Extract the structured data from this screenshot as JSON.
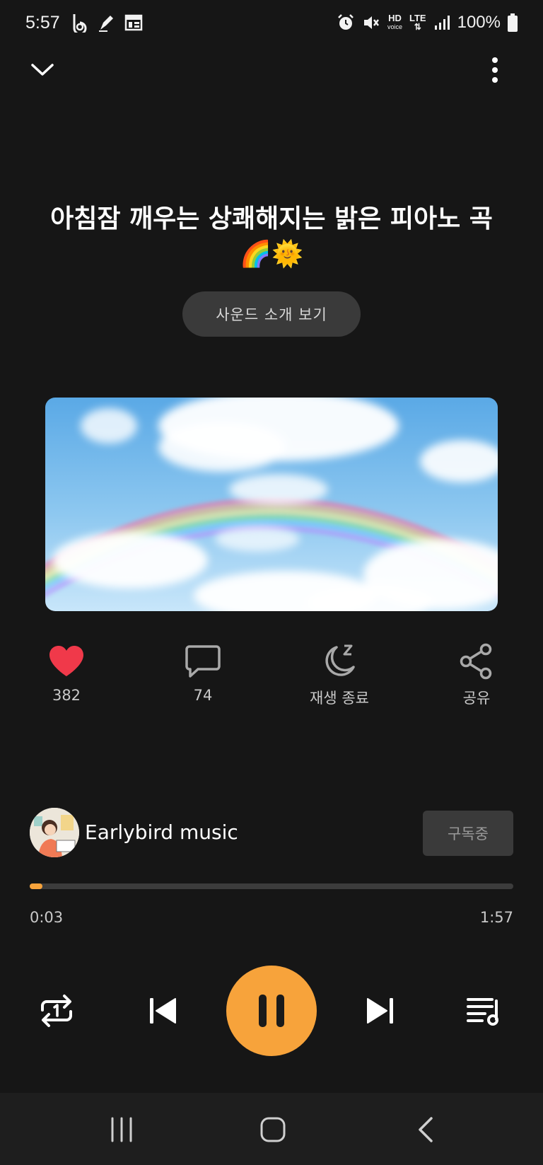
{
  "status_bar": {
    "time": "5:57",
    "battery": "100%",
    "hd_label": "HD",
    "voice_label": "voice",
    "lte_label": "LTE"
  },
  "top_bar": {
    "collapse_icon": "chevron-down-icon",
    "more_icon": "more-vertical-icon"
  },
  "track": {
    "title": "아침잠 깨우는 상쾌해지는 밝은 피아노 곡🌈🌞",
    "intro_button": "사운드 소개 보기",
    "artwork": "rainbow-sky-clouds"
  },
  "actions": [
    {
      "name": "like",
      "icon": "heart-icon",
      "label": "382",
      "color": "#f0394a"
    },
    {
      "name": "comments",
      "icon": "comment-icon",
      "label": "74"
    },
    {
      "name": "sleep-timer",
      "icon": "moon-zzz-icon",
      "label": "재생 종료"
    },
    {
      "name": "share",
      "icon": "share-icon",
      "label": "공유"
    }
  ],
  "channel": {
    "name": "Earlybird music",
    "subscribe_label": "구독중"
  },
  "playback": {
    "current_time": "0:03",
    "total_time": "1:57",
    "progress_fraction": 0.027
  },
  "controls": {
    "repeat_icon": "repeat-one-icon",
    "prev_icon": "skip-previous-icon",
    "play_state_icon": "pause-icon",
    "next_icon": "skip-next-icon",
    "playlist_icon": "playlist-icon"
  },
  "nav_bar": {
    "recents_icon": "recents-icon",
    "home_icon": "home-icon",
    "back_icon": "back-icon"
  },
  "colors": {
    "background": "#161616",
    "accent": "#f7a33b",
    "heart": "#f0394a"
  }
}
